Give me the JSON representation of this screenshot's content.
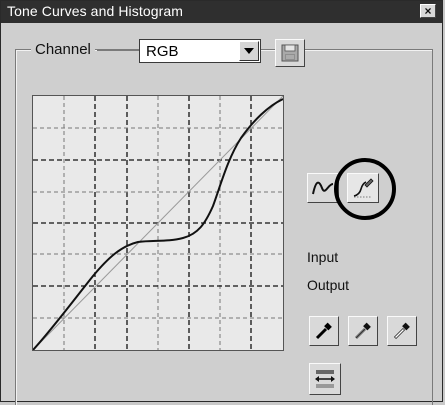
{
  "window": {
    "title": "Tone Curves and Histogram",
    "close_glyph": "×"
  },
  "channel": {
    "label": "Channel",
    "selected": "RGB"
  },
  "icons": {
    "save": "floppy-disk-icon",
    "curve_smooth": "smooth-curve-icon",
    "curve_freehand": "freehand-pen-icon",
    "black_point": "black-eyedropper-icon",
    "gray_point": "gray-eyedropper-icon",
    "white_point": "white-eyedropper-icon",
    "auto": "auto-adjust-icon"
  },
  "readouts": {
    "input_label": "Input",
    "output_label": "Output"
  },
  "colors": {
    "title_bg": "#2f2f2f",
    "panel_bg": "#cfcfcf",
    "curve": "#111111"
  }
}
